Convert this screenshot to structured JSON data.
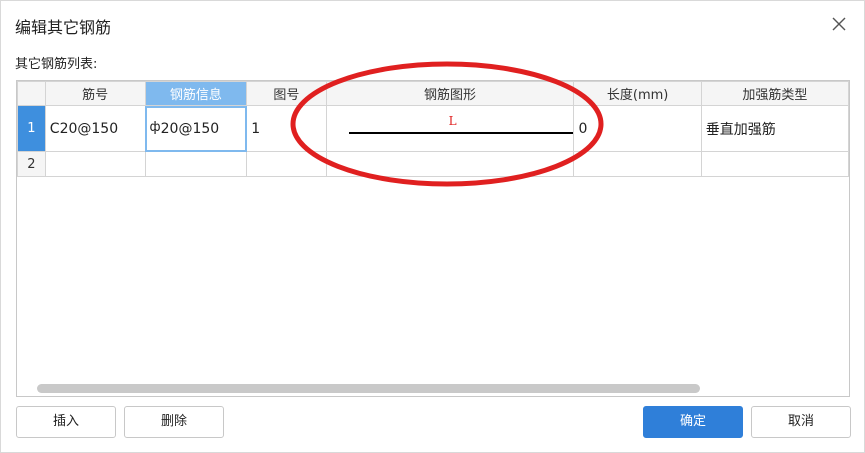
{
  "dialog": {
    "title": "编辑其它钢筋",
    "list_label": "其它钢筋列表:"
  },
  "table": {
    "columns": [
      "筋号",
      "钢筋信息",
      "图号",
      "钢筋图形",
      "长度(mm)",
      "加强筋类型"
    ],
    "active_column": "钢筋信息",
    "rows": [
      {
        "row_number": "1",
        "bar_no": "C20@150",
        "rebar_info_symbol": "ф",
        "rebar_info": "20@150",
        "figure_no": "1",
        "shape_label": "L",
        "length": "0",
        "reinforce_type": "垂直加强筋"
      },
      {
        "row_number": "2",
        "bar_no": "",
        "rebar_info_symbol": "",
        "rebar_info": "",
        "figure_no": "",
        "shape_label": "",
        "length": "",
        "reinforce_type": ""
      }
    ]
  },
  "buttons": {
    "insert": "插入",
    "delete": "删除",
    "ok": "确定",
    "cancel": "取消"
  },
  "colors": {
    "accent": "#2f7fd9",
    "header_active": "#7fb9ee",
    "row_active": "#3e8fde",
    "annotation": "#e02020"
  },
  "icons": {
    "close": "close-icon"
  }
}
